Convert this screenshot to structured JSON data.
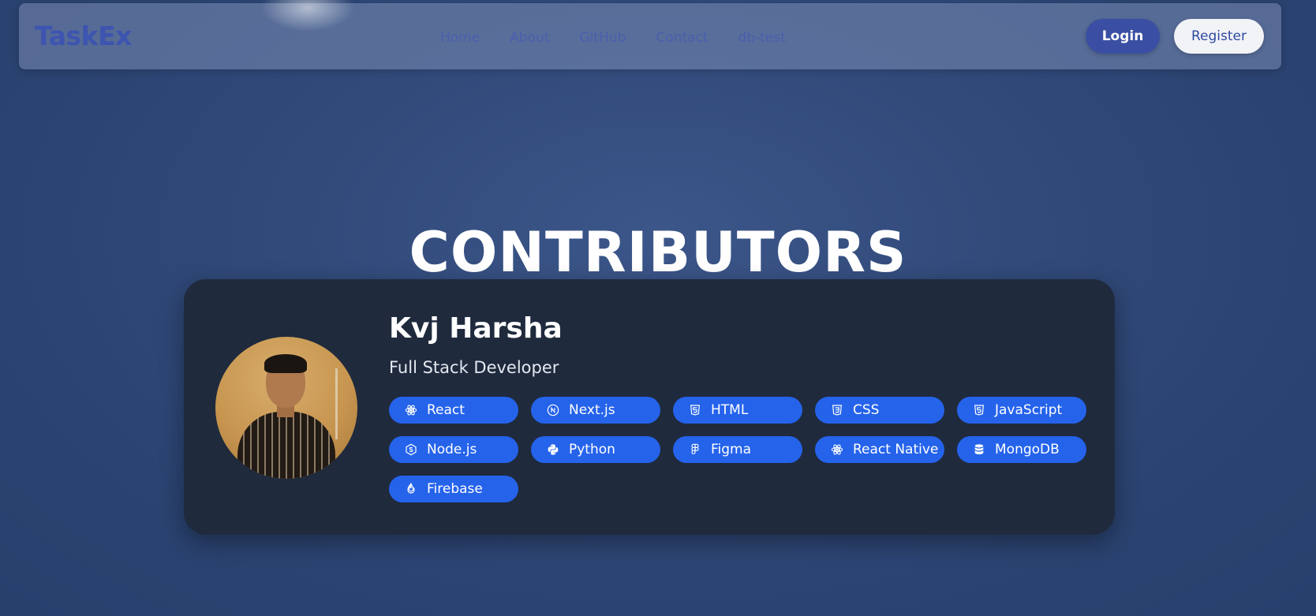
{
  "nav": {
    "logo": "TaskEx",
    "links": [
      "Home",
      "About",
      "GitHub",
      "Contact",
      "db-test"
    ],
    "login_label": "Login",
    "register_label": "Register"
  },
  "main": {
    "title": "CONTRIBUTORS"
  },
  "contributor": {
    "name": "Kvj Harsha",
    "role": "Full Stack Developer",
    "skills": [
      {
        "label": "React",
        "icon": "react-icon"
      },
      {
        "label": "Next.js",
        "icon": "nextjs-icon"
      },
      {
        "label": "HTML",
        "icon": "html5-icon"
      },
      {
        "label": "CSS",
        "icon": "css3-icon"
      },
      {
        "label": "JavaScript",
        "icon": "html5-icon"
      },
      {
        "label": "Node.js",
        "icon": "nodejs-icon"
      },
      {
        "label": "Python",
        "icon": "python-icon"
      },
      {
        "label": "Figma",
        "icon": "figma-icon"
      },
      {
        "label": "React Native",
        "icon": "react-icon"
      },
      {
        "label": "MongoDB",
        "icon": "database-icon"
      },
      {
        "label": "Firebase",
        "icon": "firebase-icon"
      }
    ]
  },
  "colors": {
    "chip": "#2563eb",
    "card": "#1f2a3d",
    "login_button": "#3a4fa3",
    "logo": "#3d54b0"
  }
}
